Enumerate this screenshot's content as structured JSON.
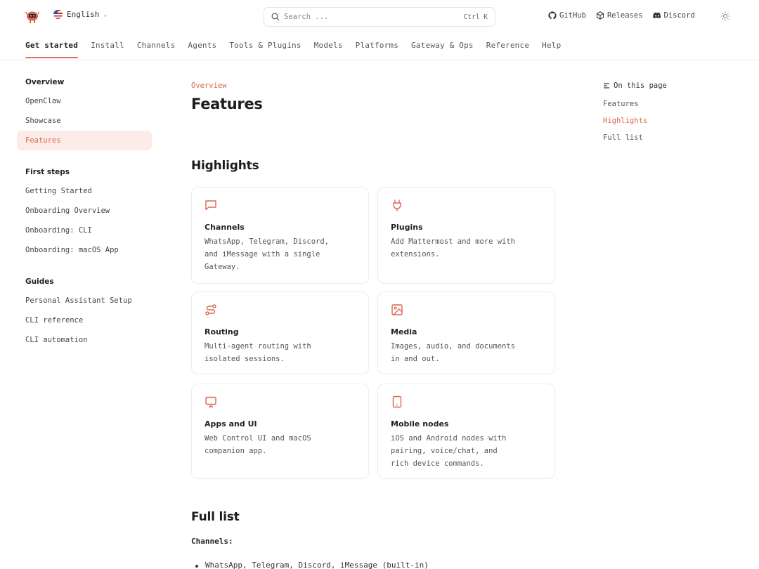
{
  "header": {
    "language": "English",
    "search_placeholder": "Search ...",
    "search_shortcut": "Ctrl K",
    "links": [
      {
        "label": "GitHub",
        "icon": "github-icon"
      },
      {
        "label": "Releases",
        "icon": "package-icon"
      },
      {
        "label": "Discord",
        "icon": "discord-icon"
      }
    ],
    "theme_icon": "sun-icon"
  },
  "tabs": [
    "Get started",
    "Install",
    "Channels",
    "Agents",
    "Tools & Plugins",
    "Models",
    "Platforms",
    "Gateway & Ops",
    "Reference",
    "Help"
  ],
  "active_tab": "Get started",
  "sidebar": {
    "groups": [
      {
        "title": "Overview",
        "items": [
          "OpenClaw",
          "Showcase",
          "Features"
        ]
      },
      {
        "title": "First steps",
        "items": [
          "Getting Started",
          "Onboarding Overview",
          "Onboarding: CLI",
          "Onboarding: macOS App"
        ]
      },
      {
        "title": "Guides",
        "items": [
          "Personal Assistant Setup",
          "CLI reference",
          "CLI automation"
        ]
      }
    ],
    "active_item": "Features"
  },
  "main": {
    "eyebrow": "Overview",
    "title": "Features",
    "highlights_heading": "Highlights",
    "cards": [
      {
        "icon": "message-square-icon",
        "title": "Channels",
        "desc": [
          "WhatsApp, Telegram, Discord,",
          "and iMessage with a single",
          "Gateway."
        ]
      },
      {
        "icon": "plug-icon",
        "title": "Plugins",
        "desc": [
          "Add Mattermost and more with",
          "extensions."
        ]
      },
      {
        "icon": "route-icon",
        "title": "Routing",
        "desc": [
          "Multi-agent routing with",
          "isolated sessions."
        ]
      },
      {
        "icon": "image-icon",
        "title": "Media",
        "desc": [
          "Images, audio, and documents",
          "in and out."
        ]
      },
      {
        "icon": "monitor-icon",
        "title": "Apps and UI",
        "desc": [
          "Web Control UI and macOS",
          "companion app."
        ]
      },
      {
        "icon": "tablet-icon",
        "title": "Mobile nodes",
        "desc": [
          "iOS and Android nodes with",
          "pairing, voice/chat, and",
          "rich device commands."
        ]
      }
    ],
    "full_list_heading": "Full list",
    "channels_subhead": "Channels:",
    "channels_list": [
      "WhatsApp, Telegram, Discord, iMessage (built-in)"
    ]
  },
  "toc": {
    "title": "On this page",
    "items": [
      "Features",
      "Highlights",
      "Full list"
    ],
    "active": "Highlights"
  },
  "colors": {
    "accent": "#d8674f",
    "accent_bg": "#fcece7",
    "border": "#ececec"
  }
}
